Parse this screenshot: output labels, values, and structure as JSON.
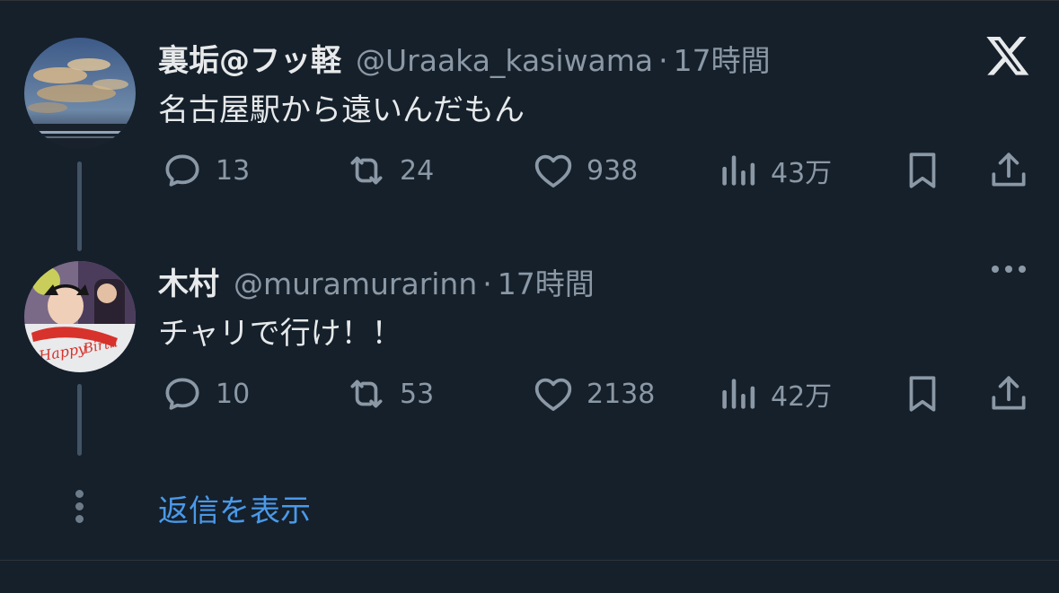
{
  "tweets": [
    {
      "name": "裏垢@フッ軽",
      "handle": "@Uraaka_kasiwama",
      "separator": "·",
      "time": "17時間",
      "text": "名古屋駅から遠いんだもん",
      "stats": {
        "replies": "13",
        "retweets": "24",
        "likes": "938",
        "views": "43万"
      }
    },
    {
      "name": "木村",
      "handle": "@muramurarinn",
      "separator": "·",
      "time": "17時間",
      "text": "チャリで行け！！",
      "stats": {
        "replies": "10",
        "retweets": "53",
        "likes": "2138",
        "views": "42万"
      }
    }
  ],
  "show_replies_label": "返信を表示",
  "colors": {
    "background": "#15202b",
    "text_primary": "#e7e9ea",
    "text_secondary": "#8b98a5",
    "link": "#4a99e9",
    "thread_line": "#425364"
  },
  "icons": {
    "reply": "speech-bubble-icon",
    "retweet": "retweet-arrows-icon",
    "like": "heart-icon",
    "views": "bar-chart-icon",
    "bookmark": "bookmark-icon",
    "share": "share-upload-icon",
    "brand": "x-logo-icon",
    "more": "ellipsis-icon"
  }
}
